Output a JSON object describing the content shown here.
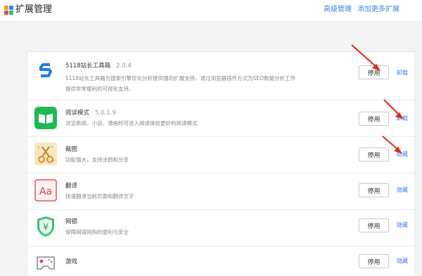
{
  "header": {
    "title": "扩展管理",
    "advanced_link": "高级管理",
    "more_link": "添加更多扩展"
  },
  "extensions": [
    {
      "name": "5118站长工具箱",
      "version": "2.0.4",
      "desc_lines": [
        "5118站长工具箱为搜索引擎优化分析提供强劲扩展支持，通过浏览器插件方式为SEO数据分析工作",
        "提供非常便利的可视化支持。"
      ],
      "disable_label": "停用",
      "action_label": "卸载",
      "icon": "5118-s-logo-icon"
    },
    {
      "name": "阅读模式",
      "version": "5.0.1.9",
      "desc_lines": [
        "浏览新闻、小说、漫画时可进入阅读体验更好的阅读模式"
      ],
      "disable_label": "停用",
      "action_label": "卸载",
      "icon": "open-book-icon"
    },
    {
      "name": "截图",
      "version": "",
      "desc_lines": [
        "功能强大，支持涂鸦和分享"
      ],
      "disable_label": "停用",
      "action_label": "隐藏",
      "icon": "scissors-icon"
    },
    {
      "name": "翻译",
      "version": "",
      "desc_lines": [
        "快速翻译当前页面和翻译文字"
      ],
      "disable_label": "停用",
      "action_label": "隐藏",
      "icon": "translate-aa-icon"
    },
    {
      "name": "网银",
      "version": "",
      "desc_lines": [
        "保障网银网购的便利与安全"
      ],
      "disable_label": "停用",
      "action_label": "隐藏",
      "icon": "yen-shield-icon"
    },
    {
      "name": "游戏",
      "version": "",
      "desc_lines": [],
      "disable_label": "停用",
      "action_label": "隐藏",
      "icon": "gamepad-icon"
    }
  ],
  "colors": {
    "link": "#3b82f6",
    "arrow": "#e8261e",
    "green": "#1db954",
    "shield": "#3ec27a"
  }
}
